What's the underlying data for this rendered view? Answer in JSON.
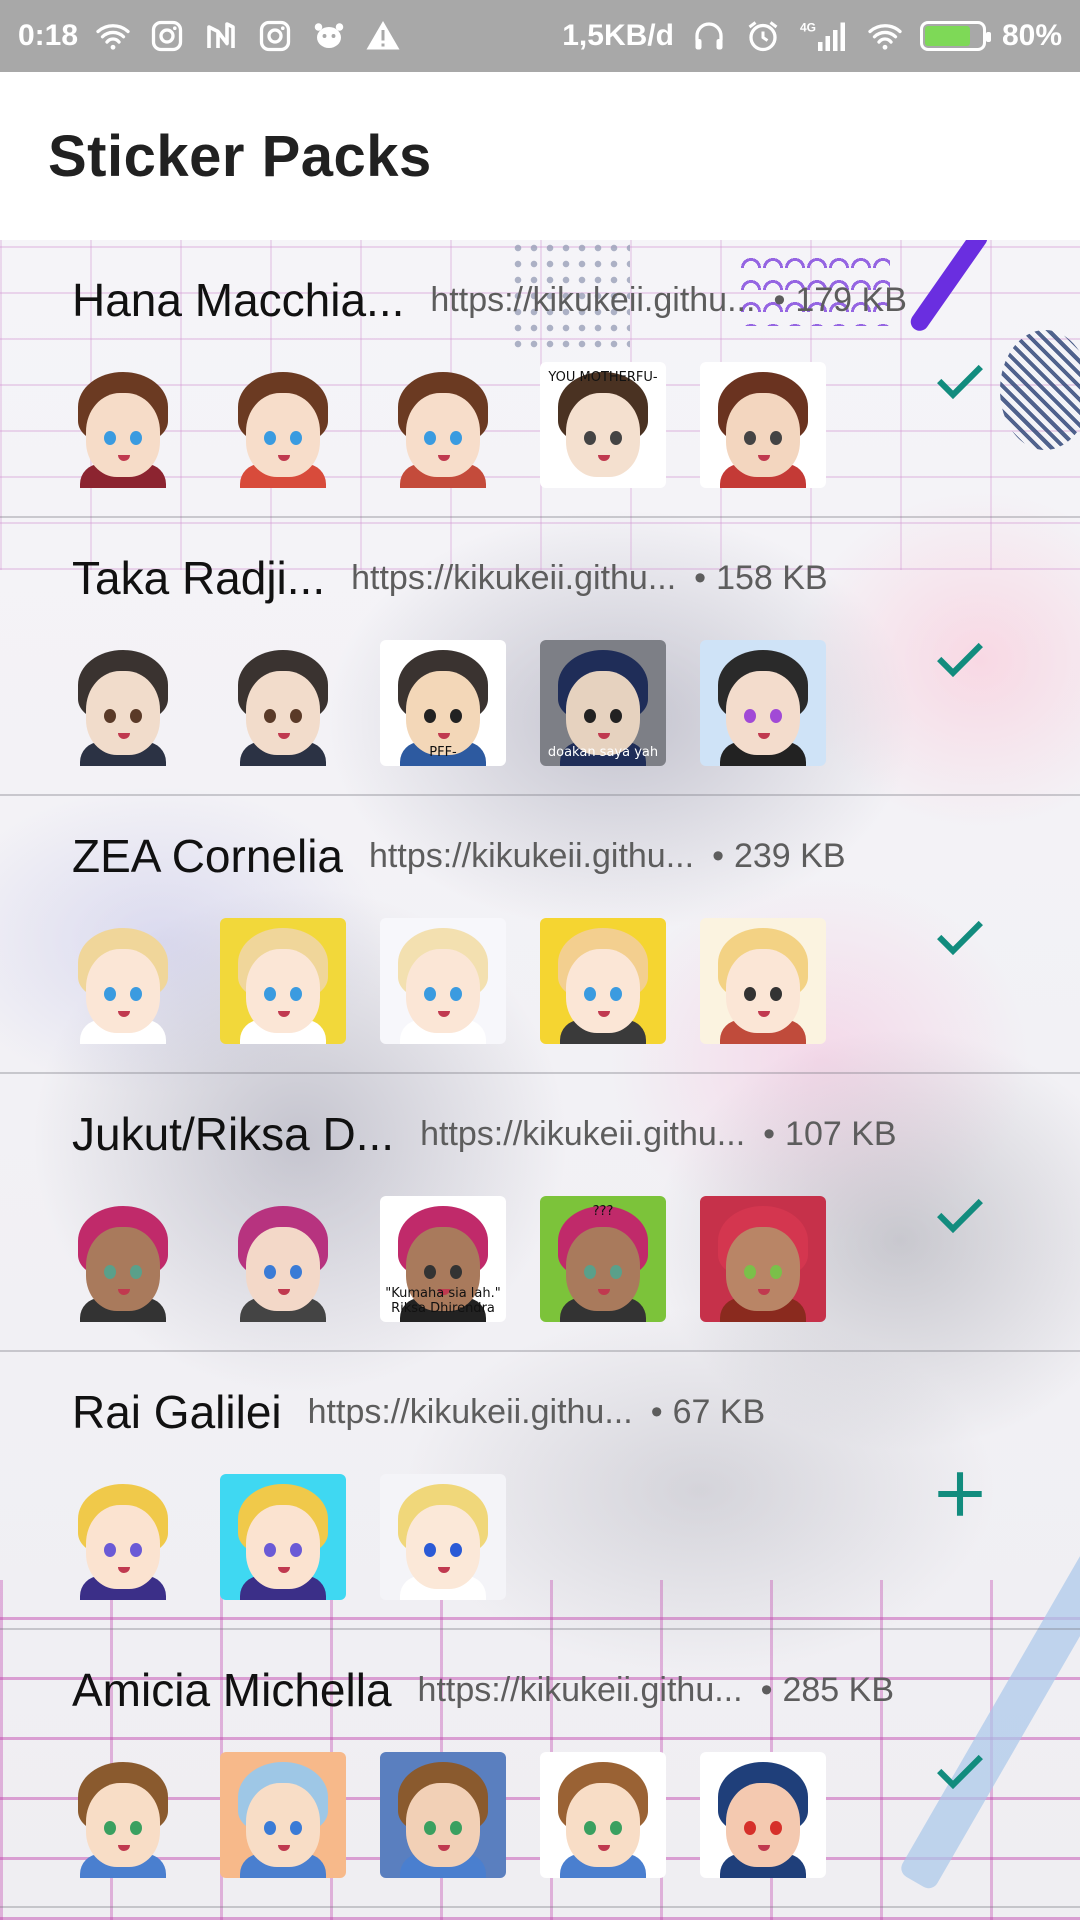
{
  "status_bar": {
    "time": "0:18",
    "network_speed": "1,5KB/d",
    "network_type": "4G",
    "battery_percent": "80%",
    "battery_level": 0.8,
    "left_icons": [
      "wifi-icon",
      "instagram-icon",
      "app-n-icon",
      "instagram-icon",
      "tiger-icon",
      "warning-icon"
    ],
    "right_icons": [
      "headset-icon",
      "alarm-icon",
      "signal-icon",
      "wifi-icon",
      "battery-charging-icon"
    ]
  },
  "app_bar": {
    "title": "Sticker Packs"
  },
  "colors": {
    "accent": "#128C7E",
    "status_bar": "#a8a8a8",
    "title_text": "#212121",
    "secondary_text": "#5d5d5d"
  },
  "packs": [
    {
      "name": "Hana Macchia...",
      "publisher": "https://kikukeii.githu...",
      "size": "179 KB",
      "action": "added-check-icon",
      "stickers": [
        {
          "hair": "#6b3a22",
          "skin": "#f6dcc8",
          "body": "#8c2430",
          "eye": "#3a9be0"
        },
        {
          "hair": "#6b3a22",
          "skin": "#f7ddca",
          "body": "#d84b3b",
          "eye": "#3a9be0"
        },
        {
          "hair": "#6b3a22",
          "skin": "#f7ddca",
          "body": "#c44b3b",
          "eye": "#3a9be0"
        },
        {
          "hair": "#4a3222",
          "skin": "#f4e0cf",
          "body": "#ffffff",
          "eye": "#444444",
          "bg": "#ffffff",
          "caption": "YOU MOTHERFU-",
          "caption_dark": true,
          "caption_top": true
        },
        {
          "hair": "#6a3320",
          "skin": "#f3d6bf",
          "body": "#c43a36",
          "eye": "#444444",
          "bg": "#ffffff"
        }
      ]
    },
    {
      "name": "Taka Radji...",
      "publisher": "https://kikukeii.githu...",
      "size": "158 KB",
      "action": "added-check-icon",
      "stickers": [
        {
          "hair": "#3a3330",
          "skin": "#f1dccb",
          "body": "#2b3244",
          "eye": "#5a3a28"
        },
        {
          "hair": "#3a3330",
          "skin": "#f2dccb",
          "body": "#2b3244",
          "eye": "#5a3a28"
        },
        {
          "hair": "#3a3330",
          "skin": "#f3d7b8",
          "body": "#2d5aa0",
          "eye": "#222222",
          "bg": "#ffffff",
          "caption": "PFF-",
          "caption_dark": true
        },
        {
          "hair": "#1f2d58",
          "skin": "#e6d2bf",
          "body": "#1f2d58",
          "eye": "#222222",
          "bg": "#7d7f86",
          "caption": "doakan saya yah"
        },
        {
          "hair": "#2a2a2a",
          "skin": "#f3dccc",
          "body": "#222222",
          "eye": "#a14ad6",
          "bg": "#cfe3f7"
        }
      ]
    },
    {
      "name": "ZEA Cornelia",
      "publisher": "https://kikukeii.githu...",
      "size": "239 KB",
      "action": "added-check-icon",
      "stickers": [
        {
          "hair": "#f0d69a",
          "skin": "#fbe6d6",
          "body": "#ffffff",
          "eye": "#3a9be0"
        },
        {
          "hair": "#f0d69a",
          "skin": "#fbe6d6",
          "body": "#ffffff",
          "eye": "#3a9be0",
          "bg": "#f2d83a"
        },
        {
          "hair": "#f3e0b0",
          "skin": "#fbe6d6",
          "body": "#ffffff",
          "eye": "#3a9be0",
          "bg": "#f7f7fb"
        },
        {
          "hair": "#f3cf8f",
          "skin": "#fbe6d6",
          "body": "#3a3a3a",
          "eye": "#3a9be0",
          "bg": "#f5d531"
        },
        {
          "hair": "#f3d284",
          "skin": "#fbe6d6",
          "body": "#c04b3b",
          "eye": "#333333",
          "bg": "#fbf3e0"
        }
      ]
    },
    {
      "name": "Jukut/Riksa D...",
      "publisher": "https://kikukeii.githu...",
      "size": "107 KB",
      "action": "added-check-icon",
      "stickers": [
        {
          "hair": "#c02a6a",
          "skin": "#a97a5c",
          "body": "#333333",
          "eye": "#5aa08a"
        },
        {
          "hair": "#b7337f",
          "skin": "#f3d8c8",
          "body": "#444444",
          "eye": "#3a7bd6"
        },
        {
          "hair": "#c02a6a",
          "skin": "#a97a5c",
          "body": "#222222",
          "eye": "#333333",
          "bg": "#ffffff",
          "caption": "\"Kumaha sia lah.\" Riksa Dhirendra",
          "caption_dark": true
        },
        {
          "hair": "#c02a6a",
          "skin": "#a97a5c",
          "body": "#333333",
          "eye": "#5aa08a",
          "bg": "#7cc33a",
          "caption": "???",
          "caption_dark": true,
          "caption_top": true
        },
        {
          "hair": "#d4364f",
          "skin": "#b98566",
          "body": "#8a2a1e",
          "eye": "#7ac04a",
          "bg": "#c6314a"
        }
      ]
    },
    {
      "name": "Rai Galilei",
      "publisher": "https://kikukeii.githu...",
      "size": "67 KB",
      "action": "add-plus-icon",
      "stickers": [
        {
          "hair": "#f0c94a",
          "skin": "#fbe3d0",
          "body": "#3b2f88",
          "eye": "#6a5ad6"
        },
        {
          "hair": "#f0c94a",
          "skin": "#fbe3d0",
          "body": "#3b2f88",
          "eye": "#6a5ad6",
          "bg": "#3fd8f2"
        },
        {
          "hair": "#f0d77a",
          "skin": "#fbe8d8",
          "body": "#ffffff",
          "eye": "#2a5ad6",
          "bg": "#f4f4f8"
        }
      ]
    },
    {
      "name": "Amicia Michella",
      "publisher": "https://kikukeii.githu...",
      "size": "285 KB",
      "action": "added-check-icon",
      "stickers": [
        {
          "hair": "#8a5a2e",
          "skin": "#f8ddc6",
          "body": "#4a7fcf",
          "eye": "#3aa060"
        },
        {
          "hair": "#9ec7e6",
          "skin": "#f8ddc6",
          "body": "#4a7fcf",
          "eye": "#3a7bd6",
          "bg": "#f7b98a"
        },
        {
          "hair": "#8a5a2e",
          "skin": "#f2d0b6",
          "body": "#4a7fcf",
          "eye": "#3aa060",
          "bg": "#5a7fbf"
        },
        {
          "hair": "#9a6234",
          "skin": "#f8ddc6",
          "body": "#4a7fcf",
          "eye": "#3aa060",
          "bg": "#ffffff"
        },
        {
          "hair": "#1f3f7a",
          "skin": "#f4c9b0",
          "body": "#1f3f7a",
          "eye": "#d6302a",
          "bg": "#ffffff"
        }
      ]
    }
  ]
}
